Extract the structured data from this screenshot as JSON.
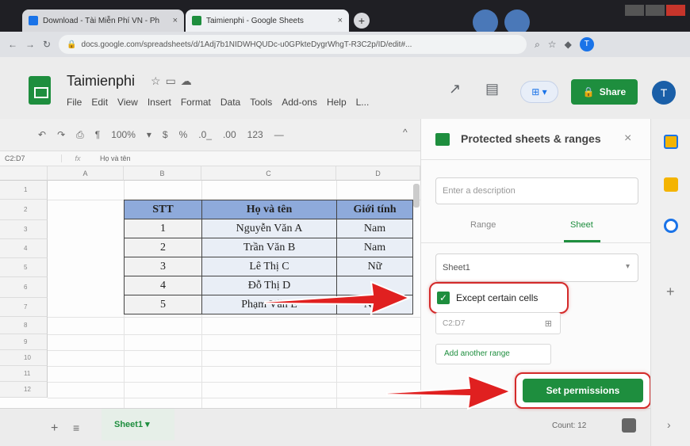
{
  "browser": {
    "tabs": [
      {
        "label": "Download - Tài Miễn Phí VN - Ph",
        "color": "#1a73e8"
      },
      {
        "label": "Taimienphi - Google Sheets",
        "color": "#1e8e3e"
      }
    ],
    "url": "docs.google.com/spreadsheets/d/1Adj7b1NIDWHQUDc-u0GPkteDygrWhgT-R3C2p/ID/edit#..."
  },
  "doc": {
    "title": "Taimienphi",
    "menu": [
      "File",
      "Edit",
      "View",
      "Insert",
      "Format",
      "Data",
      "Tools",
      "Add-ons",
      "Help",
      "L..."
    ],
    "share_label": "Share",
    "account_initial": "T"
  },
  "toolbar": {
    "zoom": "100%",
    "currency": "$",
    "percent": "%",
    "decimals_dec": ".0_",
    "decimals_inc": ".00",
    "format_more": "123"
  },
  "formula": {
    "name_box": "C2:D7",
    "fx": "fx",
    "value": "Họ và tên"
  },
  "grid": {
    "columns": [
      "A",
      "B",
      "C",
      "D"
    ],
    "rows": [
      "1",
      "2",
      "3",
      "4",
      "5",
      "6",
      "7",
      "8",
      "9",
      "10",
      "11",
      "12"
    ]
  },
  "table": {
    "headers": [
      "STT",
      "Họ và tên",
      "Giới tính"
    ],
    "rows": [
      [
        "1",
        "Nguyễn Văn A",
        "Nam"
      ],
      [
        "2",
        "Trần Văn B",
        "Nam"
      ],
      [
        "3",
        "Lê Thị C",
        "Nữ"
      ],
      [
        "4",
        "Đỗ Thị D",
        ""
      ],
      [
        "5",
        "Phạm Văn E",
        "Nam"
      ]
    ]
  },
  "bottom": {
    "sheet_tab": "Sheet1",
    "count": "Count: 12"
  },
  "panel": {
    "title": "Protected sheets & ranges",
    "description_placeholder": "Enter a description",
    "tab_range": "Range",
    "tab_sheet": "Sheet",
    "sheet_select": "Sheet1",
    "except_label": "Except certain cells",
    "except_checked": true,
    "range_value": "C2:D7",
    "add_range": "Add another range",
    "set_permissions": "Set permissions"
  },
  "colors": {
    "green": "#1e8e3e",
    "annotation_red": "#d42a2a",
    "header_blue": "#8eaadb"
  }
}
